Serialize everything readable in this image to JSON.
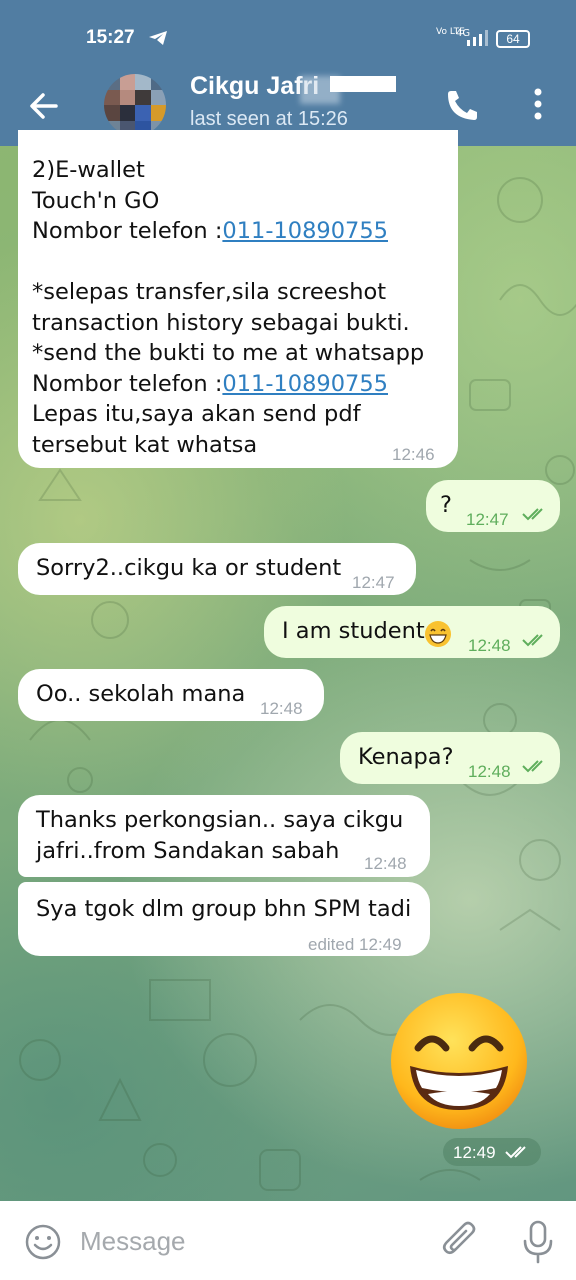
{
  "status_bar": {
    "time": "15:27",
    "network_label": "Vo LTE",
    "network_type": "4G",
    "battery": "64",
    "icons": [
      "telegram-send-icon",
      "signal-icon",
      "battery-icon"
    ]
  },
  "header": {
    "title": "Cikgu Jafri",
    "subtitle": "last seen at 15:26",
    "icons": [
      "back-arrow-icon",
      "phone-icon",
      "more-vert-icon"
    ]
  },
  "messages": [
    {
      "direction": "in",
      "lines": [
        "2)E-wallet",
        "Touch'n GO",
        "Nombor telefon :",
        "",
        "*selepas transfer,sila screeshot",
        "transaction history sebagai bukti.",
        "*send the bukti to me at whatsapp",
        "Nombor telefon :",
        "Lepas itu,saya akan send pdf",
        "tersebut kat whatsa"
      ],
      "phone_link_1": "011-10890755",
      "phone_link_2": "011-10890755",
      "time": "12:46"
    },
    {
      "direction": "out",
      "text": "?",
      "time": "12:47",
      "read": true
    },
    {
      "direction": "in",
      "text": "Sorry2..cikgu ka or student",
      "time": "12:47"
    },
    {
      "direction": "out",
      "text": "I am student",
      "emoji": "grin",
      "time": "12:48",
      "read": true
    },
    {
      "direction": "in",
      "text": "Oo.. sekolah mana",
      "time": "12:48"
    },
    {
      "direction": "out",
      "text": "Kenapa?",
      "time": "12:48",
      "read": true
    },
    {
      "direction": "in",
      "lines": [
        "Thanks perkongsian.. saya cikgu",
        "jafri..from Sandakan sabah"
      ],
      "time": "12:48"
    },
    {
      "direction": "in",
      "text": "Sya tgok dlm group bhn SPM tadi",
      "time": "edited 12:49"
    },
    {
      "direction": "out",
      "sticker": "grinning-face-sticker",
      "time": "12:49",
      "read": true
    }
  ],
  "input_bar": {
    "placeholder": "Message",
    "icons": [
      "emoji-icon",
      "attach-icon",
      "mic-icon"
    ]
  },
  "colors": {
    "header_bg": "#517da2",
    "incoming_bubble": "#ffffff",
    "outgoing_bubble": "#effdde",
    "outgoing_meta": "#5fae5c",
    "link": "#2f7fc1"
  }
}
